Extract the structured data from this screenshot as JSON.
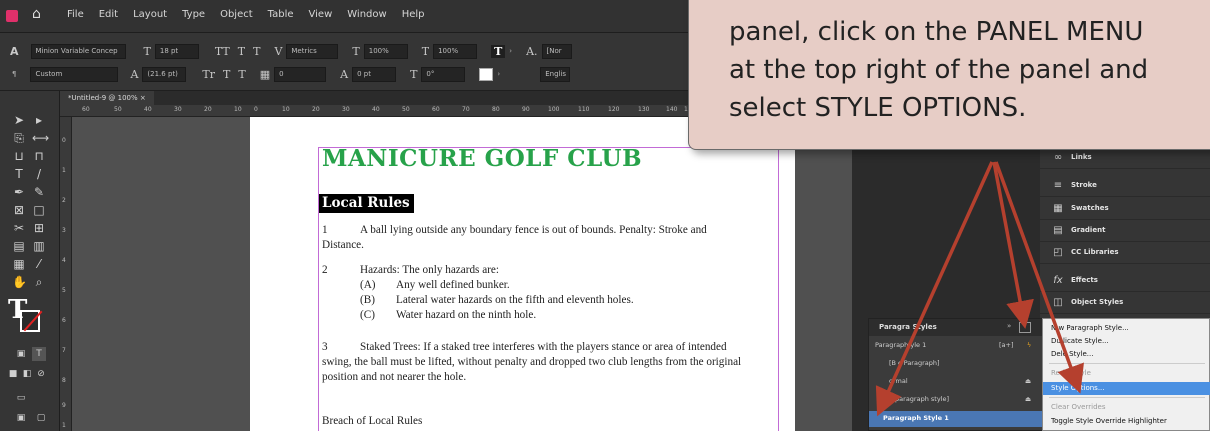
{
  "menubar": {
    "items": [
      "File",
      "Edit",
      "Layout",
      "Type",
      "Object",
      "Table",
      "View",
      "Window",
      "Help"
    ]
  },
  "control": {
    "row1": {
      "font_family": "Minion Variable Concep",
      "size": "18 pt",
      "kerning": "Metrics",
      "scale_v": "100%",
      "scale_h": "100%",
      "style": "[Nor"
    },
    "row2": {
      "style": "Custom",
      "leading": "(21.6 pt)",
      "tracking": "0",
      "baseline": "0 pt",
      "skew": "0°",
      "lang": "Englis"
    }
  },
  "tab": {
    "title": "*Untitled-9 @ 100% ×"
  },
  "ruler": {
    "h_ticks": [
      "60",
      "50",
      "40",
      "30",
      "20",
      "10",
      "0",
      "10",
      "20",
      "30",
      "40",
      "50",
      "60",
      "70",
      "80",
      "90",
      "100",
      "110",
      "120",
      "130",
      "140",
      "1"
    ],
    "v_ticks": [
      "0",
      "1",
      "2",
      "3",
      "4",
      "5",
      "6",
      "7",
      "8",
      "9",
      "1"
    ]
  },
  "document": {
    "heading": "MANICURE GOLF CLUB",
    "subheading": "Local Rules",
    "rule1_num": "1",
    "rule1_line1": "A ball lying outside any boundary fence is out of bounds.  Penalty: Stroke and",
    "rule1_line2": "Distance.",
    "rule2_num": "2",
    "rule2_intro": "Hazards:  The only hazards are:",
    "hazards": [
      {
        "label": "(A)",
        "text": "Any well defined bunker."
      },
      {
        "label": "(B)",
        "text": "Lateral water hazards on the fifth and eleventh holes."
      },
      {
        "label": "(C)",
        "text": "Water hazard on the ninth hole."
      }
    ],
    "rule3_num": "3",
    "rule3_line1": "Staked Trees:  If a staked tree interferes with the players stance or area of intended",
    "rule3_line2": "swing, the ball must be lifted, without penalty and dropped two club lengths from the original",
    "rule3_line3": "position and not nearer the hole.",
    "breach": "Breach of Local Rules"
  },
  "panels": {
    "items": [
      {
        "icon": "∞",
        "label": "Links"
      },
      {
        "icon": "≡",
        "label": "Stroke"
      },
      {
        "icon": "▦",
        "label": "Swatches"
      },
      {
        "icon": "▤",
        "label": "Gradient"
      },
      {
        "icon": "◰",
        "label": "CC Libraries"
      },
      {
        "icon": "fx",
        "label": "Effects"
      },
      {
        "icon": "◫",
        "label": "Object Styles"
      }
    ]
  },
  "paragraph_styles": {
    "title": "Paragra  Styles",
    "current": "Paragraph  yle 1",
    "current_marker": "[a+]",
    "rows": [
      "[B  c Paragraph]",
      "ormal",
      "o paragraph style]",
      "Paragraph Style 1"
    ]
  },
  "context_menu": {
    "items": [
      {
        "label": "N  w Paragraph Style...",
        "disabled": false
      },
      {
        "label": "Du  licate Style...",
        "disabled": false
      },
      {
        "label": "Dele  Style...",
        "disabled": false
      },
      {
        "label": "Redef    Style",
        "disabled": true
      },
      {
        "label": "Style Options...",
        "disabled": false
      },
      {
        "label": "Clear Overrides",
        "disabled": true
      },
      {
        "label": "Toggle Style Override Highlighter",
        "disabled": false
      }
    ]
  },
  "callout": {
    "line1": "panel, click on the PANEL MENU",
    "line2": "at the top right of the panel and",
    "line3": "select STYLE OPTIONS."
  },
  "colors": {
    "heading_green": "#27a24a",
    "selection_blue": "#4a77b4",
    "menu_highlight": "#4a90e2",
    "callout_bg": "#e7cdc6",
    "arrow": "#b5402e"
  }
}
